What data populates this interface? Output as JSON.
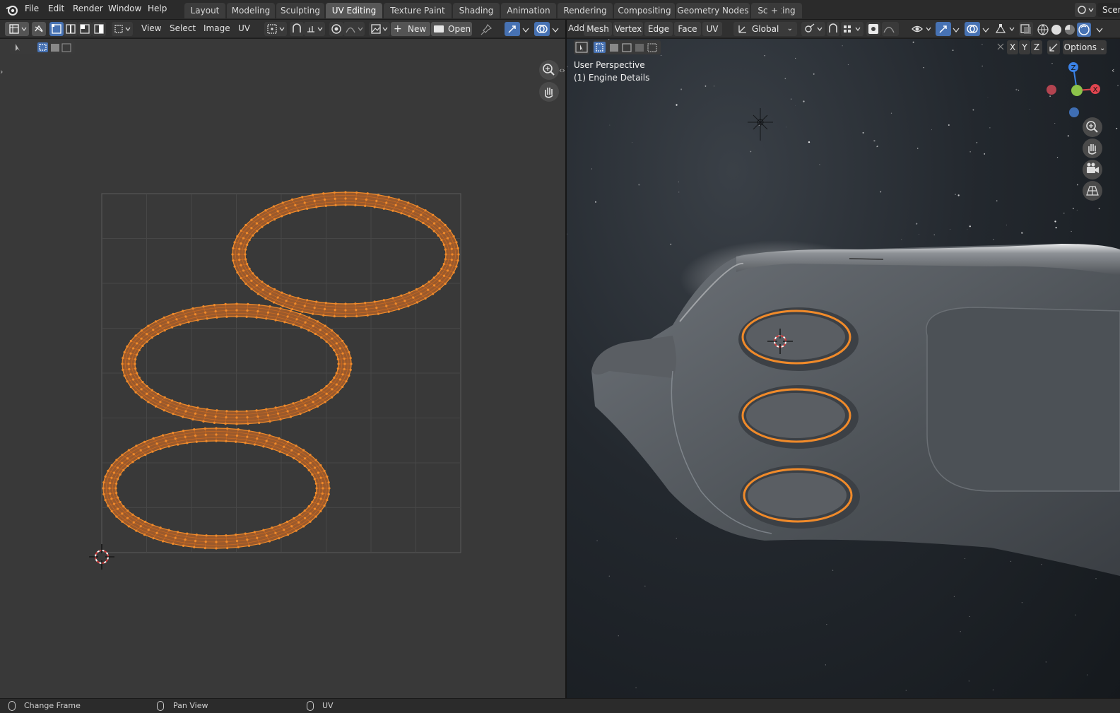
{
  "topbar": {
    "menu": [
      "File",
      "Edit",
      "Render",
      "Window",
      "Help"
    ],
    "workspace_tabs": [
      "Layout",
      "Modeling",
      "Sculpting",
      "UV Editing",
      "Texture Paint",
      "Shading",
      "Animation",
      "Rendering",
      "Compositing",
      "Geometry Nodes",
      "Scripting"
    ],
    "active_tab": "UV Editing",
    "add_tab": "+",
    "scene_label": "Scer"
  },
  "uv_header": {
    "menus": [
      "View",
      "Select",
      "Image",
      "UV"
    ],
    "new_label": "New",
    "open_label": "Open"
  },
  "viewport_header": {
    "menus": [
      "Add",
      "Mesh",
      "Vertex",
      "Edge",
      "Face",
      "UV"
    ],
    "orientation": "Global",
    "axes": [
      "X",
      "Y",
      "Z"
    ],
    "options_label": "Options"
  },
  "viewport": {
    "perspective_label": "User Perspective",
    "object_label": "(1) Engine Details",
    "gizmo": {
      "z": "Z",
      "x": "X"
    }
  },
  "statusbar": {
    "items": [
      "Change Frame",
      "Pan View",
      "UV"
    ]
  },
  "colors": {
    "accent_blue": "#4772b3",
    "uv_orange": "#f08a2a",
    "uv_fill": "#9b5a2c"
  }
}
